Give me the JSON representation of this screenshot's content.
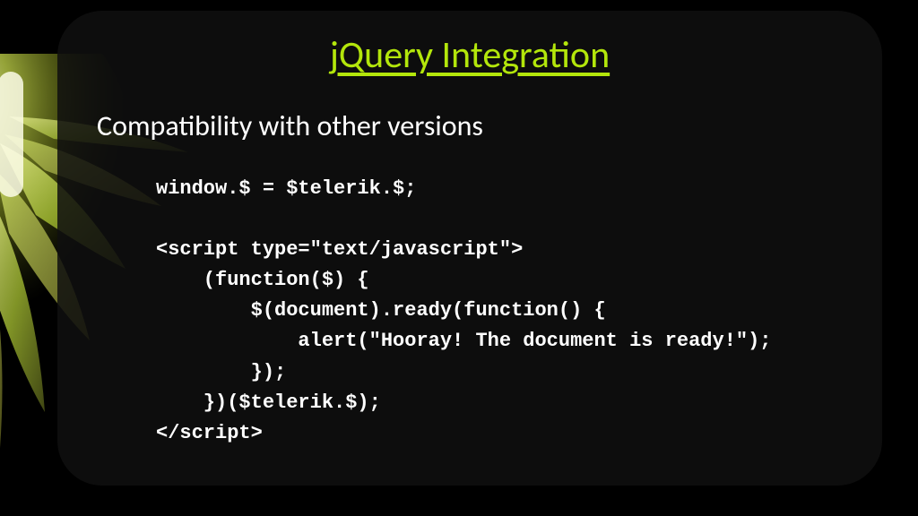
{
  "slide": {
    "title": "jQuery Integration",
    "subtitle": "Compatibility with other versions",
    "code": "window.$ = $telerik.$;\n\n<script type=\"text/javascript\">\n    (function($) {\n        $(document).ready(function() {\n            alert(\"Hooray! The document is ready!\");\n        });\n    })($telerik.$);\n</script>"
  }
}
